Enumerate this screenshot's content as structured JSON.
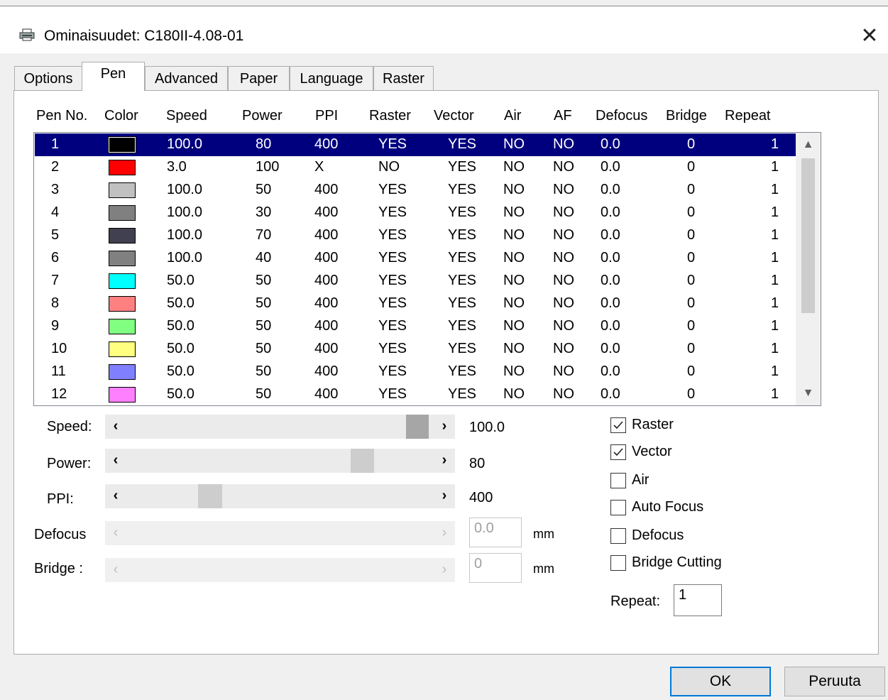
{
  "window": {
    "title": "Ominaisuudet: C180II-4.08-01",
    "close_glyph": "✕"
  },
  "tabs": [
    "Options",
    "Pen",
    "Advanced",
    "Paper",
    "Language",
    "Raster"
  ],
  "active_tab": "Pen",
  "columns": [
    "Pen No.",
    "Color",
    "Speed",
    "Power",
    "PPI",
    "Raster",
    "Vector",
    "Air",
    "AF",
    "Defocus",
    "Bridge",
    "Repeat"
  ],
  "pens": [
    {
      "no": "1",
      "color": "#000000",
      "speed": "100.0",
      "power": "80",
      "ppi": "400",
      "raster": "YES",
      "vector": "YES",
      "air": "NO",
      "af": "NO",
      "defocus": "0.0",
      "bridge": "0",
      "repeat": "1"
    },
    {
      "no": "2",
      "color": "#ff0000",
      "speed": "3.0",
      "power": "100",
      "ppi": "X",
      "raster": "NO",
      "vector": "YES",
      "air": "NO",
      "af": "NO",
      "defocus": "0.0",
      "bridge": "0",
      "repeat": "1"
    },
    {
      "no": "3",
      "color": "#c0c0c0",
      "speed": "100.0",
      "power": "50",
      "ppi": "400",
      "raster": "YES",
      "vector": "YES",
      "air": "NO",
      "af": "NO",
      "defocus": "0.0",
      "bridge": "0",
      "repeat": "1"
    },
    {
      "no": "4",
      "color": "#808080",
      "speed": "100.0",
      "power": "30",
      "ppi": "400",
      "raster": "YES",
      "vector": "YES",
      "air": "NO",
      "af": "NO",
      "defocus": "0.0",
      "bridge": "0",
      "repeat": "1"
    },
    {
      "no": "5",
      "color": "#404050",
      "speed": "100.0",
      "power": "70",
      "ppi": "400",
      "raster": "YES",
      "vector": "YES",
      "air": "NO",
      "af": "NO",
      "defocus": "0.0",
      "bridge": "0",
      "repeat": "1"
    },
    {
      "no": "6",
      "color": "#808080",
      "speed": "100.0",
      "power": "40",
      "ppi": "400",
      "raster": "YES",
      "vector": "YES",
      "air": "NO",
      "af": "NO",
      "defocus": "0.0",
      "bridge": "0",
      "repeat": "1"
    },
    {
      "no": "7",
      "color": "#00ffff",
      "speed": "50.0",
      "power": "50",
      "ppi": "400",
      "raster": "YES",
      "vector": "YES",
      "air": "NO",
      "af": "NO",
      "defocus": "0.0",
      "bridge": "0",
      "repeat": "1"
    },
    {
      "no": "8",
      "color": "#ff8080",
      "speed": "50.0",
      "power": "50",
      "ppi": "400",
      "raster": "YES",
      "vector": "YES",
      "air": "NO",
      "af": "NO",
      "defocus": "0.0",
      "bridge": "0",
      "repeat": "1"
    },
    {
      "no": "9",
      "color": "#80ff80",
      "speed": "50.0",
      "power": "50",
      "ppi": "400",
      "raster": "YES",
      "vector": "YES",
      "air": "NO",
      "af": "NO",
      "defocus": "0.0",
      "bridge": "0",
      "repeat": "1"
    },
    {
      "no": "10",
      "color": "#ffff80",
      "speed": "50.0",
      "power": "50",
      "ppi": "400",
      "raster": "YES",
      "vector": "YES",
      "air": "NO",
      "af": "NO",
      "defocus": "0.0",
      "bridge": "0",
      "repeat": "1"
    },
    {
      "no": "11",
      "color": "#8080ff",
      "speed": "50.0",
      "power": "50",
      "ppi": "400",
      "raster": "YES",
      "vector": "YES",
      "air": "NO",
      "af": "NO",
      "defocus": "0.0",
      "bridge": "0",
      "repeat": "1"
    },
    {
      "no": "12",
      "color": "#ff80ff",
      "speed": "50.0",
      "power": "50",
      "ppi": "400",
      "raster": "YES",
      "vector": "YES",
      "air": "NO",
      "af": "NO",
      "defocus": "0.0",
      "bridge": "0",
      "repeat": "1"
    }
  ],
  "selected_pen": "1",
  "controls": {
    "speed": {
      "label": "Speed:",
      "value": "100.0"
    },
    "power": {
      "label": "Power:",
      "value": "80"
    },
    "ppi": {
      "label": "PPI:",
      "value": "400"
    },
    "defocus": {
      "label": "Defocus",
      "value": "0.0",
      "unit": "mm"
    },
    "bridge": {
      "label": "Bridge :",
      "value": "0",
      "unit": "mm"
    }
  },
  "options": {
    "raster": {
      "label": "Raster",
      "checked": true
    },
    "vector": {
      "label": "Vector",
      "checked": true
    },
    "air": {
      "label": "Air",
      "checked": false
    },
    "auto_focus": {
      "label": "Auto Focus",
      "checked": false
    },
    "defocus": {
      "label": "Defocus",
      "checked": false
    },
    "bridge_cutting": {
      "label": "Bridge Cutting",
      "checked": false
    }
  },
  "repeat": {
    "label": "Repeat:",
    "value": "1"
  },
  "buttons": {
    "ok": "OK",
    "cancel": "Peruuta"
  },
  "colors": {
    "selection": "#00007f",
    "accent": "#0078d7"
  }
}
